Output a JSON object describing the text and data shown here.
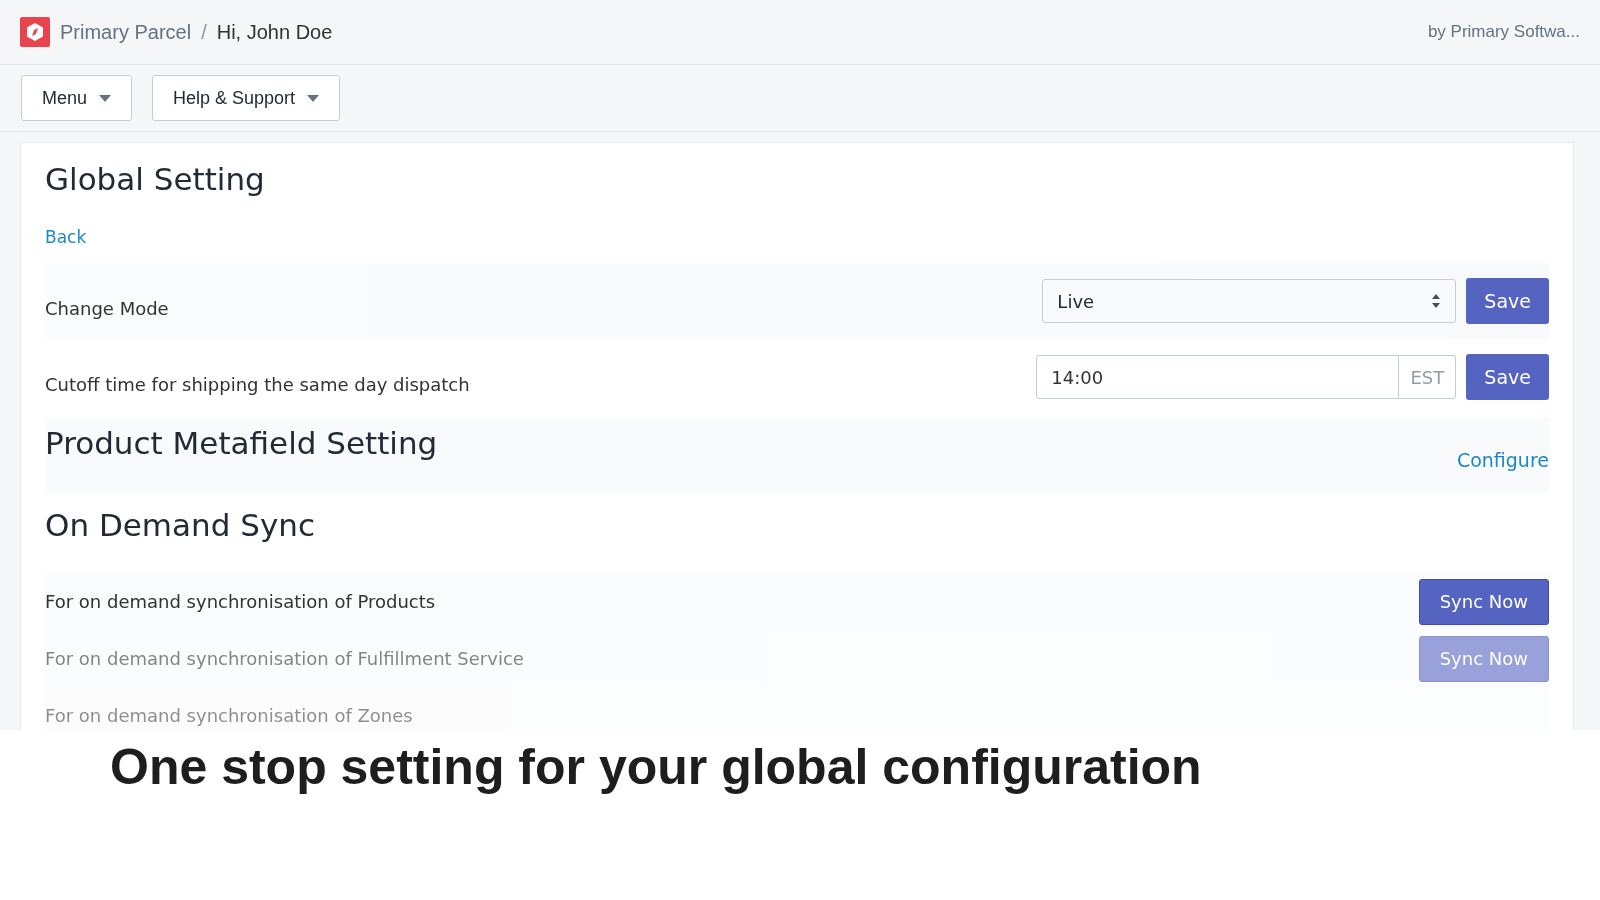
{
  "header": {
    "app_name": "Primary Parcel",
    "separator": "/",
    "greeting": "Hi, John Doe",
    "vendor": "by Primary Softwa..."
  },
  "toolbar": {
    "buttons": [
      {
        "label": "Menu"
      },
      {
        "label": "Help & Support"
      }
    ]
  },
  "page": {
    "title": "Global Setting",
    "back_link": "Back",
    "settings": [
      {
        "kind": "select",
        "label": "Change Mode",
        "value": "Live",
        "button": "Save"
      },
      {
        "kind": "time",
        "label": "Cutoff time for shipping the same day dispatch",
        "value": "14:00",
        "suffix": "EST",
        "button": "Save"
      }
    ],
    "metafield": {
      "heading": "Product Metafield Setting",
      "link": "Configure"
    },
    "sync": {
      "heading": "On Demand Sync",
      "rows": [
        {
          "label": "For on demand synchronisation of Products",
          "button": "Sync Now"
        },
        {
          "label": "For on demand synchronisation of Fulfillment Service",
          "button": "Sync Now"
        },
        {
          "label": "For on demand synchronisation of Zones"
        }
      ]
    }
  },
  "caption": "One stop setting for your global configuration"
}
